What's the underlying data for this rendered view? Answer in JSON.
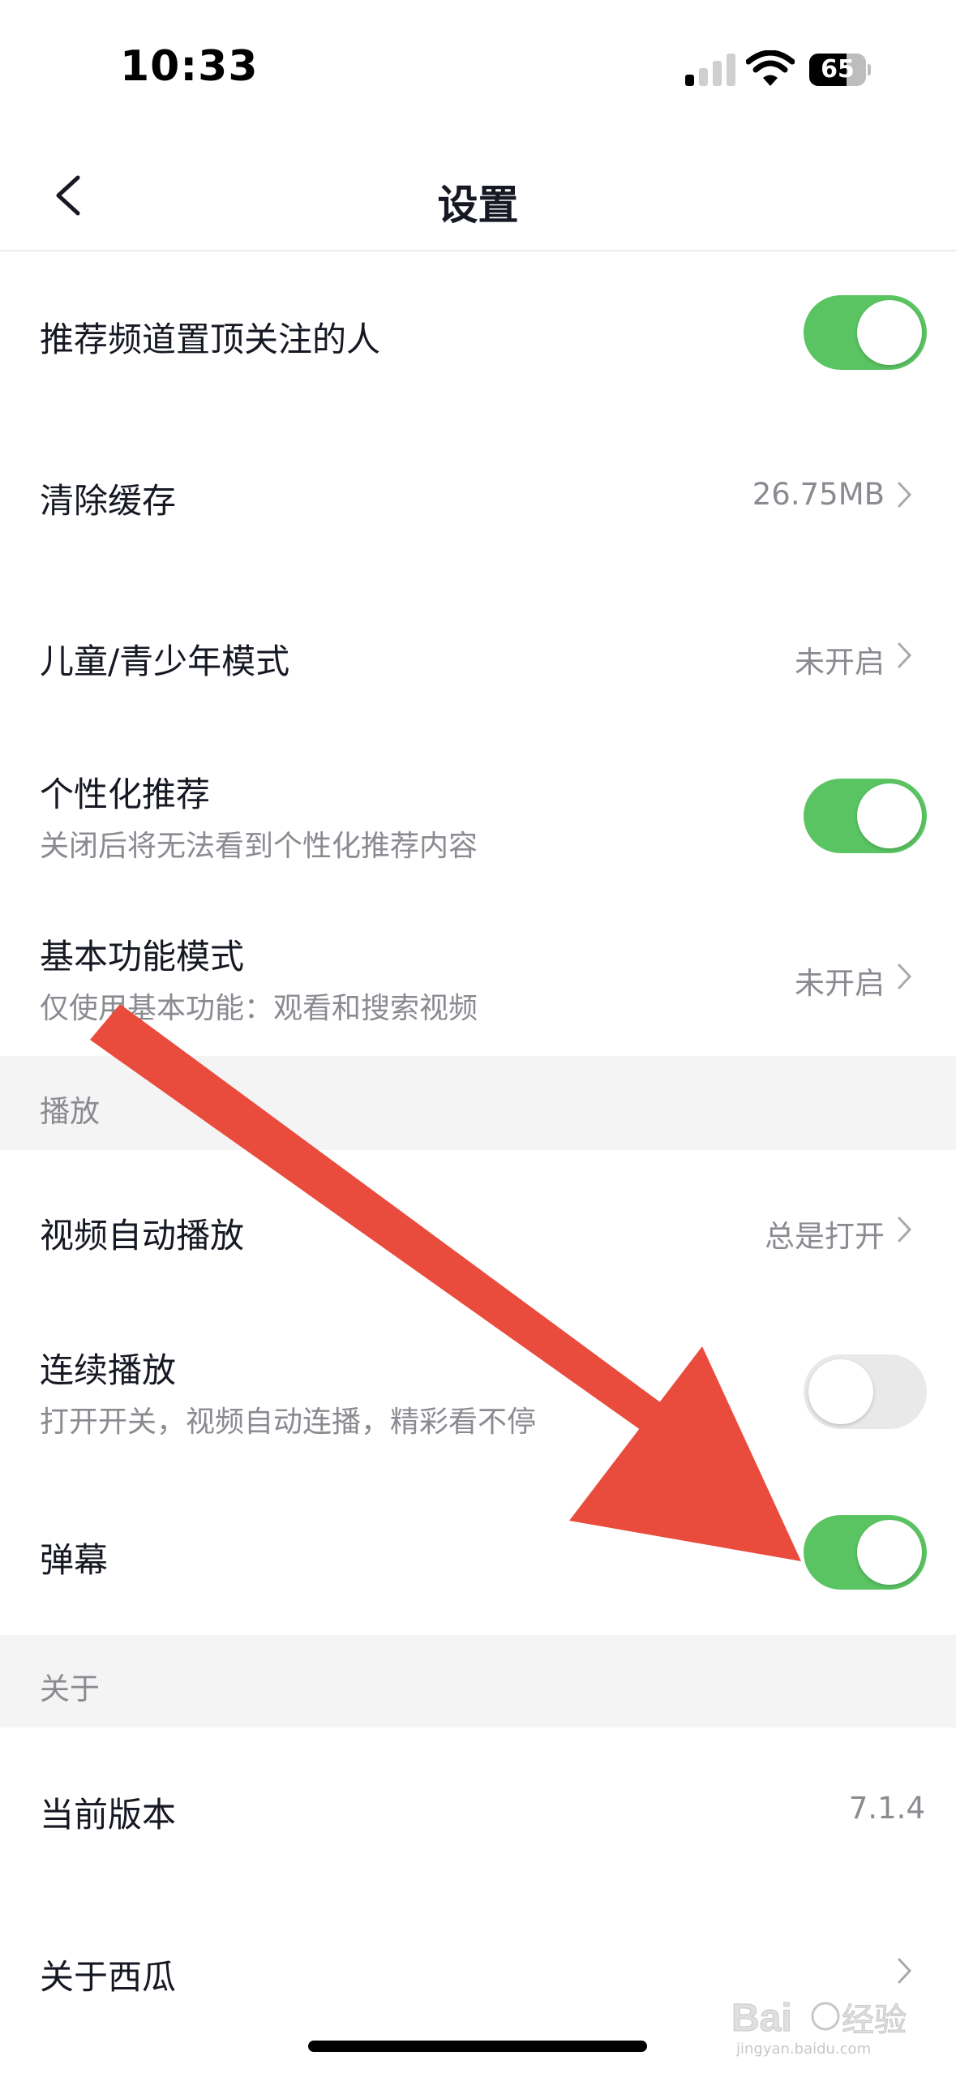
{
  "status_bar": {
    "time": "10:33",
    "battery": "65",
    "battery_level": 0.65
  },
  "nav": {
    "title": "设置"
  },
  "rows": [
    {
      "label": "推荐频道置顶关注的人",
      "control": "toggle",
      "checked": true
    },
    {
      "label": "清除缓存",
      "value": "26.75MB"
    },
    {
      "label": "儿童/青少年模式",
      "value": "未开启"
    },
    {
      "label": "个性化推荐",
      "sub": "关闭后将无法看到个性化推荐内容",
      "control": "toggle",
      "checked": true
    },
    {
      "label": "基本功能模式",
      "sub": "仅使用基本功能：观看和搜索视频",
      "value": "未开启"
    }
  ],
  "sections": {
    "playback": "播放",
    "about": "关于"
  },
  "playback_rows": [
    {
      "label": "视频自动播放",
      "value": "总是打开"
    },
    {
      "label": "连续播放",
      "sub": "打开开关，视频自动连播，精彩看不停",
      "control": "toggle",
      "checked": false
    },
    {
      "label": "弹幕",
      "control": "toggle",
      "checked": true
    }
  ],
  "about_rows": [
    {
      "label": "当前版本",
      "value": "7.1.4"
    },
    {
      "label": "关于西瓜"
    }
  ],
  "watermark": {
    "text": "Baidu经验",
    "sub": "jingyan.baidu.com"
  },
  "colors": {
    "toggle_on": "#5ac462",
    "toggle_off": "#e9e9ea",
    "annotation_arrow": "#e94c3d",
    "section_bg": "#f4f4f4"
  }
}
